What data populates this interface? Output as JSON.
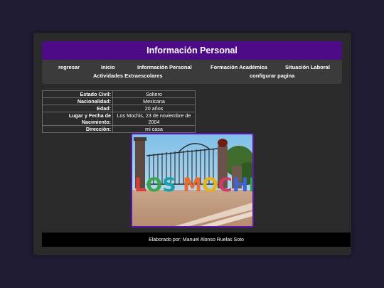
{
  "header": {
    "title": "Información Personal"
  },
  "nav": {
    "items": [
      {
        "label": "regresar"
      },
      {
        "label": "Inicio"
      },
      {
        "label": "Información Personal"
      },
      {
        "label": "Formación Académica"
      },
      {
        "label": "Situación Laboral"
      },
      {
        "label": "Actividades Extraescolares"
      },
      {
        "label": "configurar pagina"
      }
    ]
  },
  "info": {
    "rows": [
      {
        "key": "Estado Civil:",
        "value": "Soltero"
      },
      {
        "key": "Nacionalidad:",
        "value": "Mexicana"
      },
      {
        "key": "Edad:",
        "value": "20 años"
      },
      {
        "key": "Lugar y Fecha de Nacimiento:",
        "value": "Los Mochis, 23 de noviembre de 2004"
      },
      {
        "key": "Dirección:",
        "value": "mi casa"
      }
    ]
  },
  "photo": {
    "sign_text": "LOS MOCHIS"
  },
  "footer": {
    "text": "Elaborado por: Manuel Alonso Ruelas Soto"
  },
  "colors": {
    "background": "#1f1c33",
    "card": "#2a2a2a",
    "accent": "#4d0b88",
    "footer": "#000000"
  }
}
